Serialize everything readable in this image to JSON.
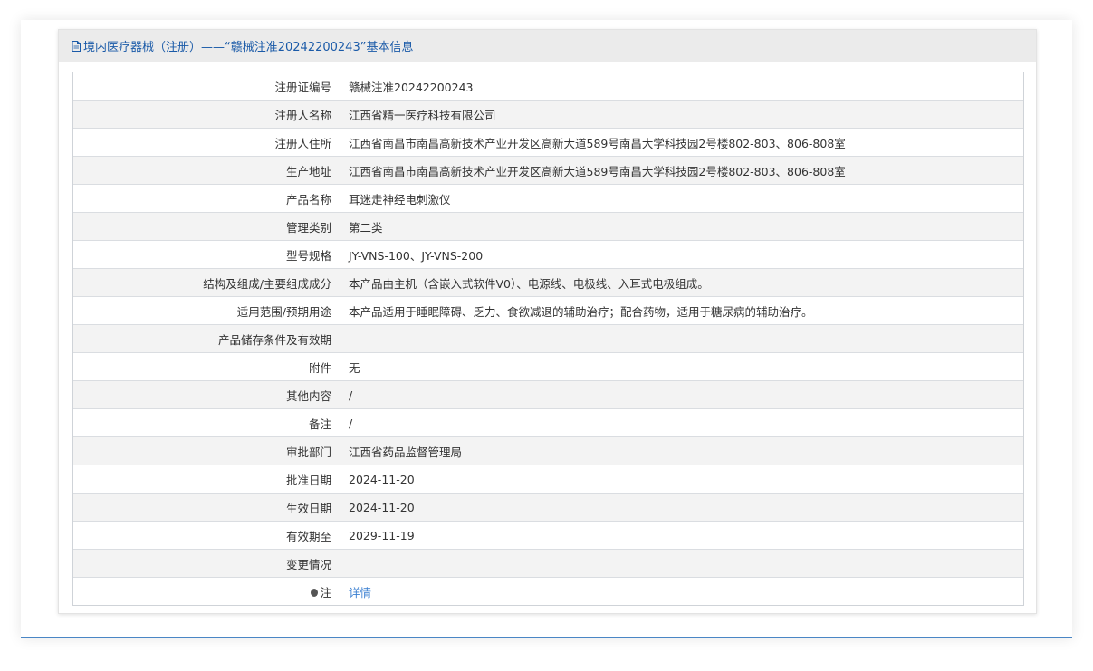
{
  "header": {
    "title": "境内医疗器械（注册）——“赣械注准20242200243”基本信息"
  },
  "rows": [
    {
      "label": "注册证编号",
      "value": "赣械注准20242200243"
    },
    {
      "label": "注册人名称",
      "value": "江西省精一医疗科技有限公司"
    },
    {
      "label": "注册人住所",
      "value": "江西省南昌市南昌高新技术产业开发区高新大道589号南昌大学科技园2号楼802-803、806-808室"
    },
    {
      "label": "生产地址",
      "value": "江西省南昌市南昌高新技术产业开发区高新大道589号南昌大学科技园2号楼802-803、806-808室"
    },
    {
      "label": "产品名称",
      "value": "耳迷走神经电刺激仪"
    },
    {
      "label": "管理类别",
      "value": "第二类"
    },
    {
      "label": "型号规格",
      "value": "JY-VNS-100、JY-VNS-200"
    },
    {
      "label": "结构及组成/主要组成成分",
      "value": "本产品由主机（含嵌入式软件V0）、电源线、电极线、入耳式电极组成。"
    },
    {
      "label": "适用范围/预期用途",
      "value": "本产品适用于睡眠障碍、乏力、食欲减退的辅助治疗；配合药物，适用于糖尿病的辅助治疗。"
    },
    {
      "label": "产品储存条件及有效期",
      "value": ""
    },
    {
      "label": "附件",
      "value": "无"
    },
    {
      "label": "其他内容",
      "value": "/"
    },
    {
      "label": "备注",
      "value": "/"
    },
    {
      "label": "审批部门",
      "value": "江西省药品监督管理局"
    },
    {
      "label": "批准日期",
      "value": "2024-11-20"
    },
    {
      "label": "生效日期",
      "value": "2024-11-20"
    },
    {
      "label": "有效期至",
      "value": "2029-11-19"
    },
    {
      "label": "变更情况",
      "value": ""
    }
  ],
  "note": {
    "label": "注",
    "link_text": "详情",
    "icon": "pin-icon"
  }
}
